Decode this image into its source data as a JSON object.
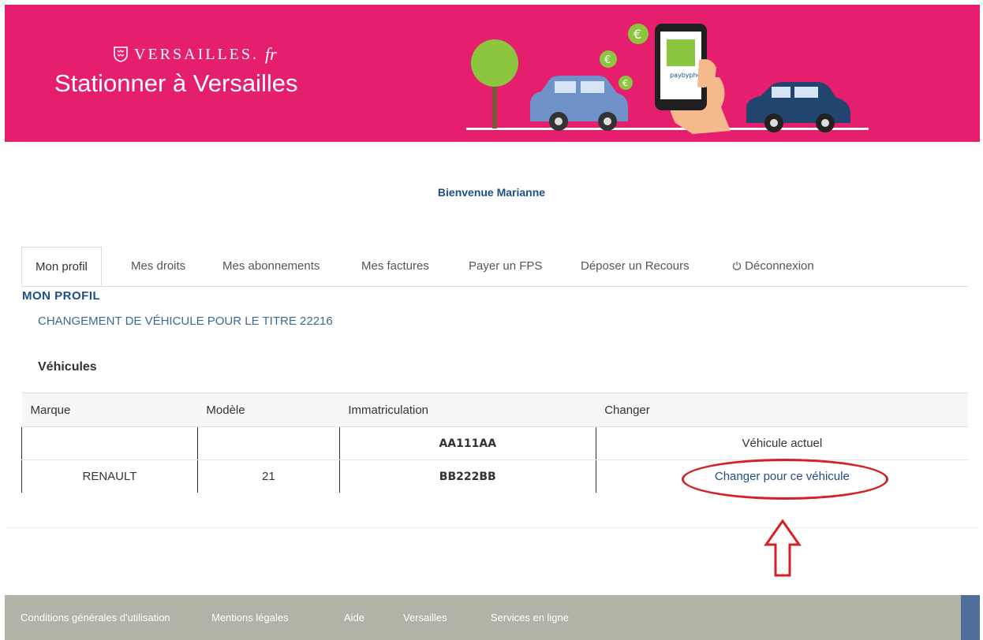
{
  "header": {
    "logo_text": "VERSAILLES.",
    "logo_suffix": "fr",
    "site_title": "Stationner à Versailles",
    "phone_text": "paybyphone",
    "colors": {
      "banner": "#e61e6e",
      "tree": "#8cc63f",
      "car_left": "#6f93c8",
      "car_right": "#21456e"
    }
  },
  "welcome": "Bienvenue Marianne",
  "tabs": [
    {
      "label": "Mon profil",
      "active": true
    },
    {
      "label": "Mes droits"
    },
    {
      "label": "Mes abonnements"
    },
    {
      "label": "Mes factures"
    },
    {
      "label": "Payer un FPS"
    },
    {
      "label": "Déposer un Recours"
    },
    {
      "label": "Déconnexion",
      "icon": "power-icon"
    }
  ],
  "section_title": "MON PROFIL",
  "subsection_title": "CHANGEMENT DE VÉHICULE POUR LE TITRE 22216",
  "vehicles_title": "Véhicules",
  "table": {
    "headers": [
      "Marque",
      "Modèle",
      "Immatriculation",
      "Changer"
    ],
    "rows": [
      {
        "marque": "",
        "modele": "",
        "immatriculation": "AA111AA",
        "changer": "Véhicule actuel"
      },
      {
        "marque": "RENAULT",
        "modele": "21",
        "immatriculation": "BB222BB",
        "changer": "Changer pour ce véhicule"
      }
    ]
  },
  "footer": {
    "links": [
      "Conditions générales d'utilisation",
      "Mentions légales",
      "Aide",
      "Versailles",
      "Services en ligne"
    ]
  }
}
